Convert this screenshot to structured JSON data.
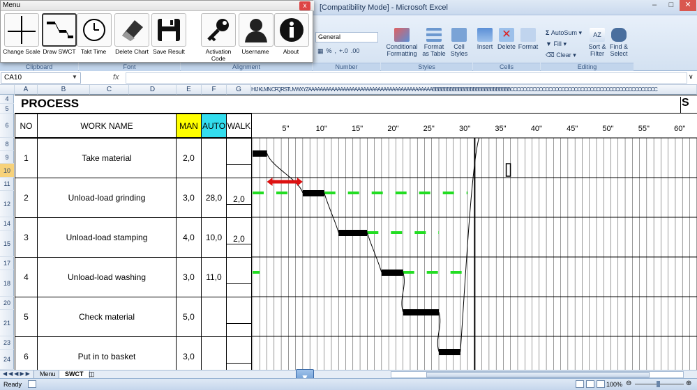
{
  "window": {
    "title": "[Compatibility Mode] - Microsoft Excel"
  },
  "menu": {
    "title": "Menu",
    "close": "x",
    "buttons": [
      {
        "label": "Change Scale",
        "icon": "cross-lines-icon"
      },
      {
        "label": "Draw SWCT",
        "icon": "step-chart-icon"
      },
      {
        "label": "Takt Time",
        "icon": "clock-icon"
      },
      {
        "label": "Delete Chart",
        "icon": "eraser-icon"
      },
      {
        "label": "Save Result",
        "icon": "floppy-disk-icon"
      },
      {
        "label": "Activation Code",
        "icon": "key-icon"
      },
      {
        "label": "Username",
        "icon": "user-silhouette-icon"
      },
      {
        "label": "About",
        "icon": "info-icon"
      }
    ]
  },
  "ribbon": {
    "number_format": "General",
    "groups": {
      "clipboard": "Clipboard",
      "font": "Font",
      "alignment": "Alignment",
      "number": "Number",
      "styles": "Styles",
      "cells": "Cells",
      "editing": "Editing"
    },
    "number_buttons": {
      "percent": "%",
      "comma": ",",
      "inc_dec": "+.0",
      "dec_dec": ".00"
    },
    "styles": {
      "conditional": "Conditional\nFormatting",
      "format_table": "Format\nas Table",
      "cell_styles": "Cell\nStyles"
    },
    "cells": {
      "insert": "Insert",
      "delete": "Delete",
      "format": "Format"
    },
    "editing": {
      "autosum": "AutoSum",
      "fill": "Fill",
      "clear": "Clear",
      "sort": "Sort &\nFilter",
      "find": "Find &\nSelect"
    }
  },
  "formula_bar": {
    "name_box": "CA10",
    "fx": "fx",
    "value": ""
  },
  "columns": [
    "A",
    "B",
    "C",
    "D",
    "E",
    "F",
    "G"
  ],
  "narrow_columns_text": "H IJ KLMN CFQRSTUVWXYZAAAAAAAAAAAAAAAAAAAAAAAAAAAAAAAAAAAAAAAAAAABBBBBBBBBBBBBBBBBBBBBBBBBBBCCCCCCCCCCCCCCCCCCCCCCCCCCCCCCCCCCCCCCCCCCCCCC",
  "row_numbers": [
    "4",
    "5",
    "6",
    "8",
    "9",
    "10",
    "11",
    "12",
    "14",
    "15",
    "17",
    "18",
    "20",
    "21",
    "23",
    "24"
  ],
  "sheet": {
    "process_title": "PROCESS",
    "right_s": "S",
    "headers": {
      "no": "NO",
      "work_name": "WORK NAME",
      "man": "MAN",
      "auto": "AUTO",
      "walk": "WALK"
    },
    "time_ticks": [
      "5\"",
      "10\"",
      "15\"",
      "20\"",
      "25\"",
      "30\"",
      "35\"",
      "40\"",
      "45\"",
      "50\"",
      "55\"",
      "60\""
    ],
    "rows": [
      {
        "no": "1",
        "name": "Take material",
        "man": "2,0",
        "auto": "",
        "walk": ""
      },
      {
        "no": "2",
        "name": "Unload-load grinding",
        "man": "3,0",
        "auto": "28,0",
        "walk": "2,0"
      },
      {
        "no": "3",
        "name": "Unload-load stamping",
        "man": "4,0",
        "auto": "10,0",
        "walk": "2,0"
      },
      {
        "no": "4",
        "name": "Unload-load washing",
        "man": "3,0",
        "auto": "11,0",
        "walk": ""
      },
      {
        "no": "5",
        "name": "Check material",
        "man": "5,0",
        "auto": "",
        "walk": ""
      },
      {
        "no": "6",
        "name": "Put in to basket",
        "man": "3,0",
        "auto": "",
        "walk": ""
      }
    ]
  },
  "chart_data": {
    "type": "gantt",
    "title": "",
    "x_unit": "seconds",
    "xlim": [
      0,
      60
    ],
    "takt_time": 31,
    "man_bars": [
      {
        "row": 1,
        "start": 0,
        "end": 2
      },
      {
        "row": 2,
        "start": 7,
        "end": 10
      },
      {
        "row": 3,
        "start": 12,
        "end": 16
      },
      {
        "row": 4,
        "start": 18,
        "end": 21
      },
      {
        "row": 5,
        "start": 21,
        "end": 26
      },
      {
        "row": 6,
        "start": 26,
        "end": 29
      }
    ],
    "auto_bars": [
      {
        "row": 2,
        "start": 10,
        "end": 30
      },
      {
        "row": 2,
        "start": 0,
        "end": 5
      },
      {
        "row": 3,
        "start": 16,
        "end": 26
      },
      {
        "row": 4,
        "start": 21,
        "end": 30
      },
      {
        "row": 4,
        "start": 0,
        "end": 1
      }
    ],
    "walk_arrow": {
      "row": 2,
      "start": 2,
      "end": 7
    },
    "colors": {
      "man": "#000000",
      "auto": "#22dd22",
      "walk": "#dd1111",
      "man_header": "#ffff00",
      "auto_header": "#33ddee"
    }
  },
  "tabs": [
    "Menu",
    "SWCT"
  ],
  "status": {
    "ready": "Ready",
    "zoom": "100%"
  }
}
